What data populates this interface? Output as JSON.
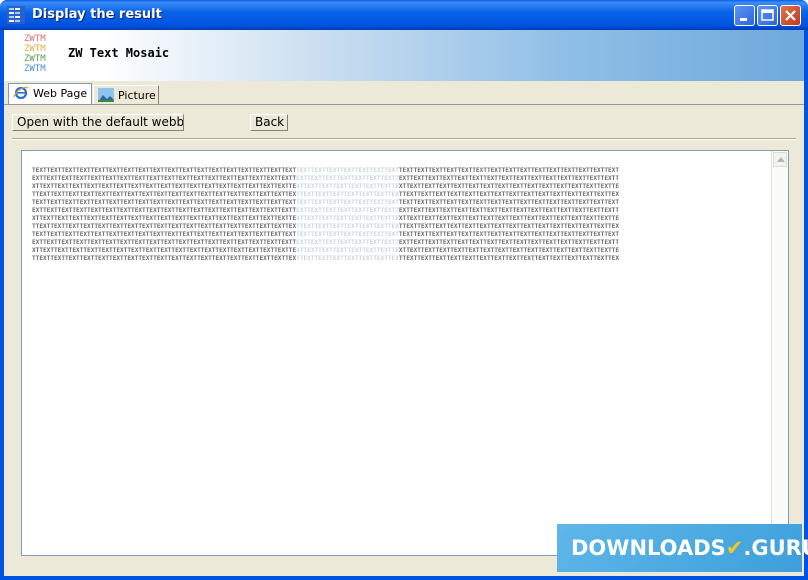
{
  "window": {
    "title": "Display the result"
  },
  "banner": {
    "logo_lines": [
      "ZWTM",
      "ZWTM",
      "ZWTM",
      "ZWTM"
    ],
    "title": "ZW Text Mosaic"
  },
  "tabs": [
    {
      "label": "Web Page",
      "icon": "ie-icon",
      "active": true
    },
    {
      "label": "Picture",
      "icon": "landscape-picture-icon",
      "active": false
    }
  ],
  "toolbar": {
    "open_label": "Open with the default webbrowser",
    "back_label": "Back"
  },
  "mosaic": {
    "text": "TEXT",
    "rows": 12
  },
  "watermark": {
    "text_a": "DOWNLOADS",
    "text_b": ".GURU"
  },
  "colors": {
    "titlebar": "#0053e0",
    "window_bg": "#ece9d8"
  }
}
